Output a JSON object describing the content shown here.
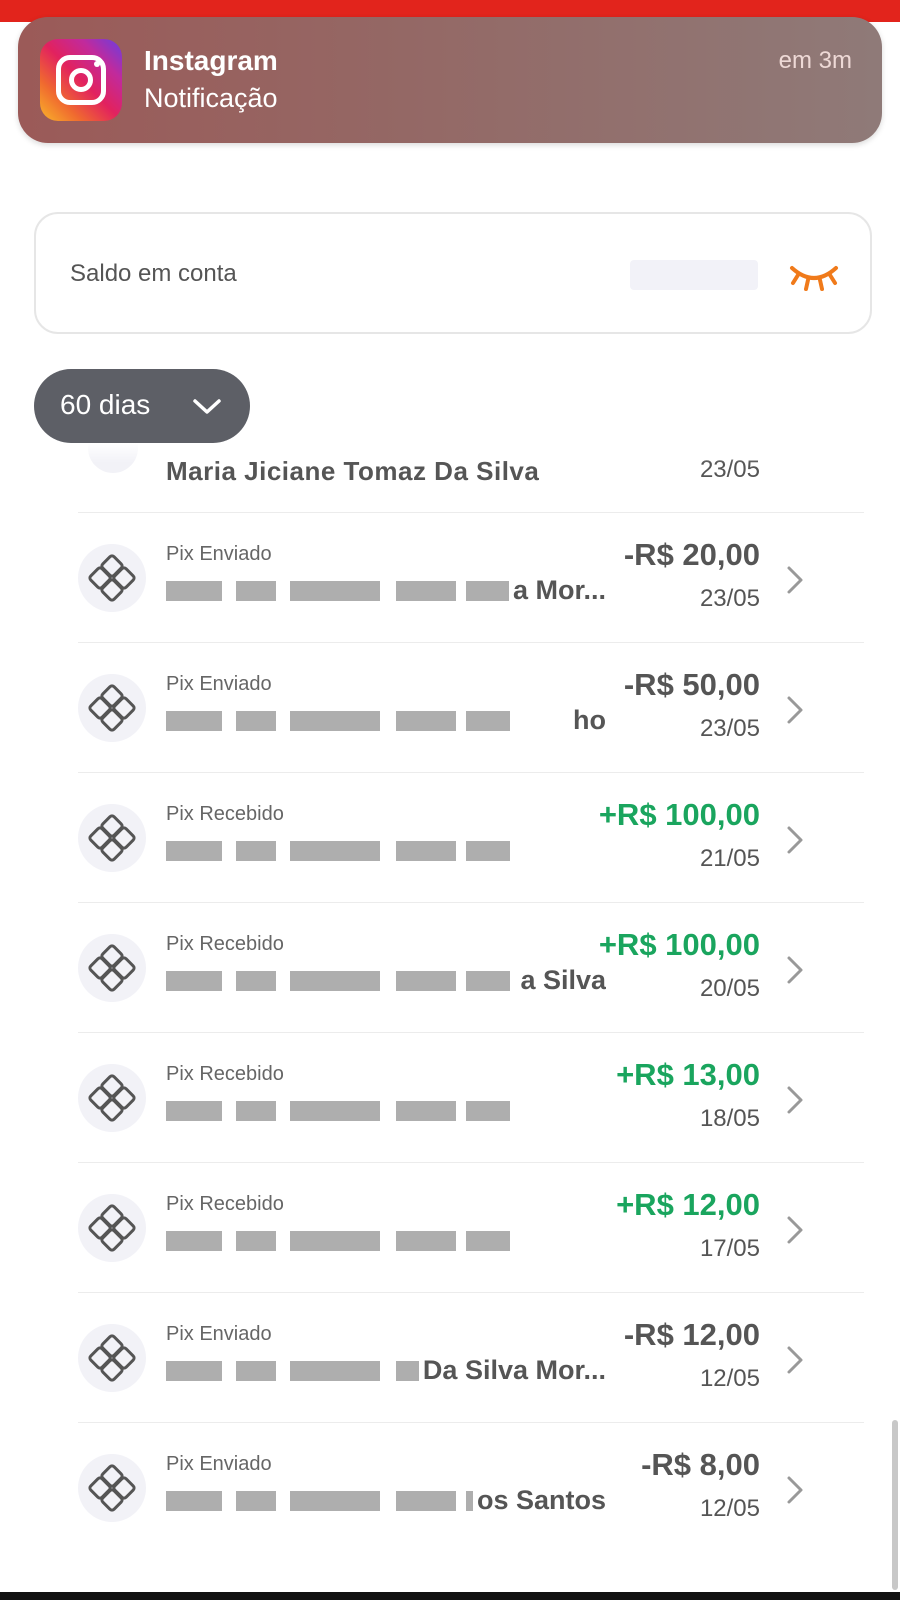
{
  "notification": {
    "app": "Instagram",
    "body": "Notificação",
    "time": "em 3m",
    "icon": "instagram-icon"
  },
  "balance": {
    "label": "Saldo em conta",
    "eye_icon": "eye-closed-icon",
    "accent": "#f07a1a"
  },
  "filter": {
    "period": "60 dias",
    "icon": "chevron-down-icon"
  },
  "partial_row": {
    "name": "Maria Jiciane Tomaz Da Silva",
    "date": "23/05"
  },
  "transactions": [
    {
      "type": "Pix Enviado",
      "name_tail": "a Mor...",
      "amount": "-R$ 20,00",
      "date": "23/05",
      "direction": "out"
    },
    {
      "type": "Pix Enviado",
      "name_tail": "ho",
      "amount": "-R$ 50,00",
      "date": "23/05",
      "direction": "out"
    },
    {
      "type": "Pix Recebido",
      "name_tail": "",
      "amount": "+R$ 100,00",
      "date": "21/05",
      "direction": "in"
    },
    {
      "type": "Pix Recebido",
      "name_tail": "a Silva",
      "amount": "+R$ 100,00",
      "date": "20/05",
      "direction": "in"
    },
    {
      "type": "Pix Recebido",
      "name_tail": "",
      "amount": "+R$ 13,00",
      "date": "18/05",
      "direction": "in"
    },
    {
      "type": "Pix Recebido",
      "name_tail": "",
      "amount": "+R$ 12,00",
      "date": "17/05",
      "direction": "in"
    },
    {
      "type": "Pix Enviado",
      "name_tail": "Da Silva Mor...",
      "amount": "-R$ 12,00",
      "date": "12/05",
      "direction": "out"
    },
    {
      "type": "Pix Enviado",
      "name_tail": "os Santos",
      "amount": "-R$ 8,00",
      "date": "12/05",
      "direction": "out"
    }
  ],
  "colors": {
    "income": "#1aa55e",
    "expense": "#555555",
    "brand_red": "#e2241c"
  }
}
